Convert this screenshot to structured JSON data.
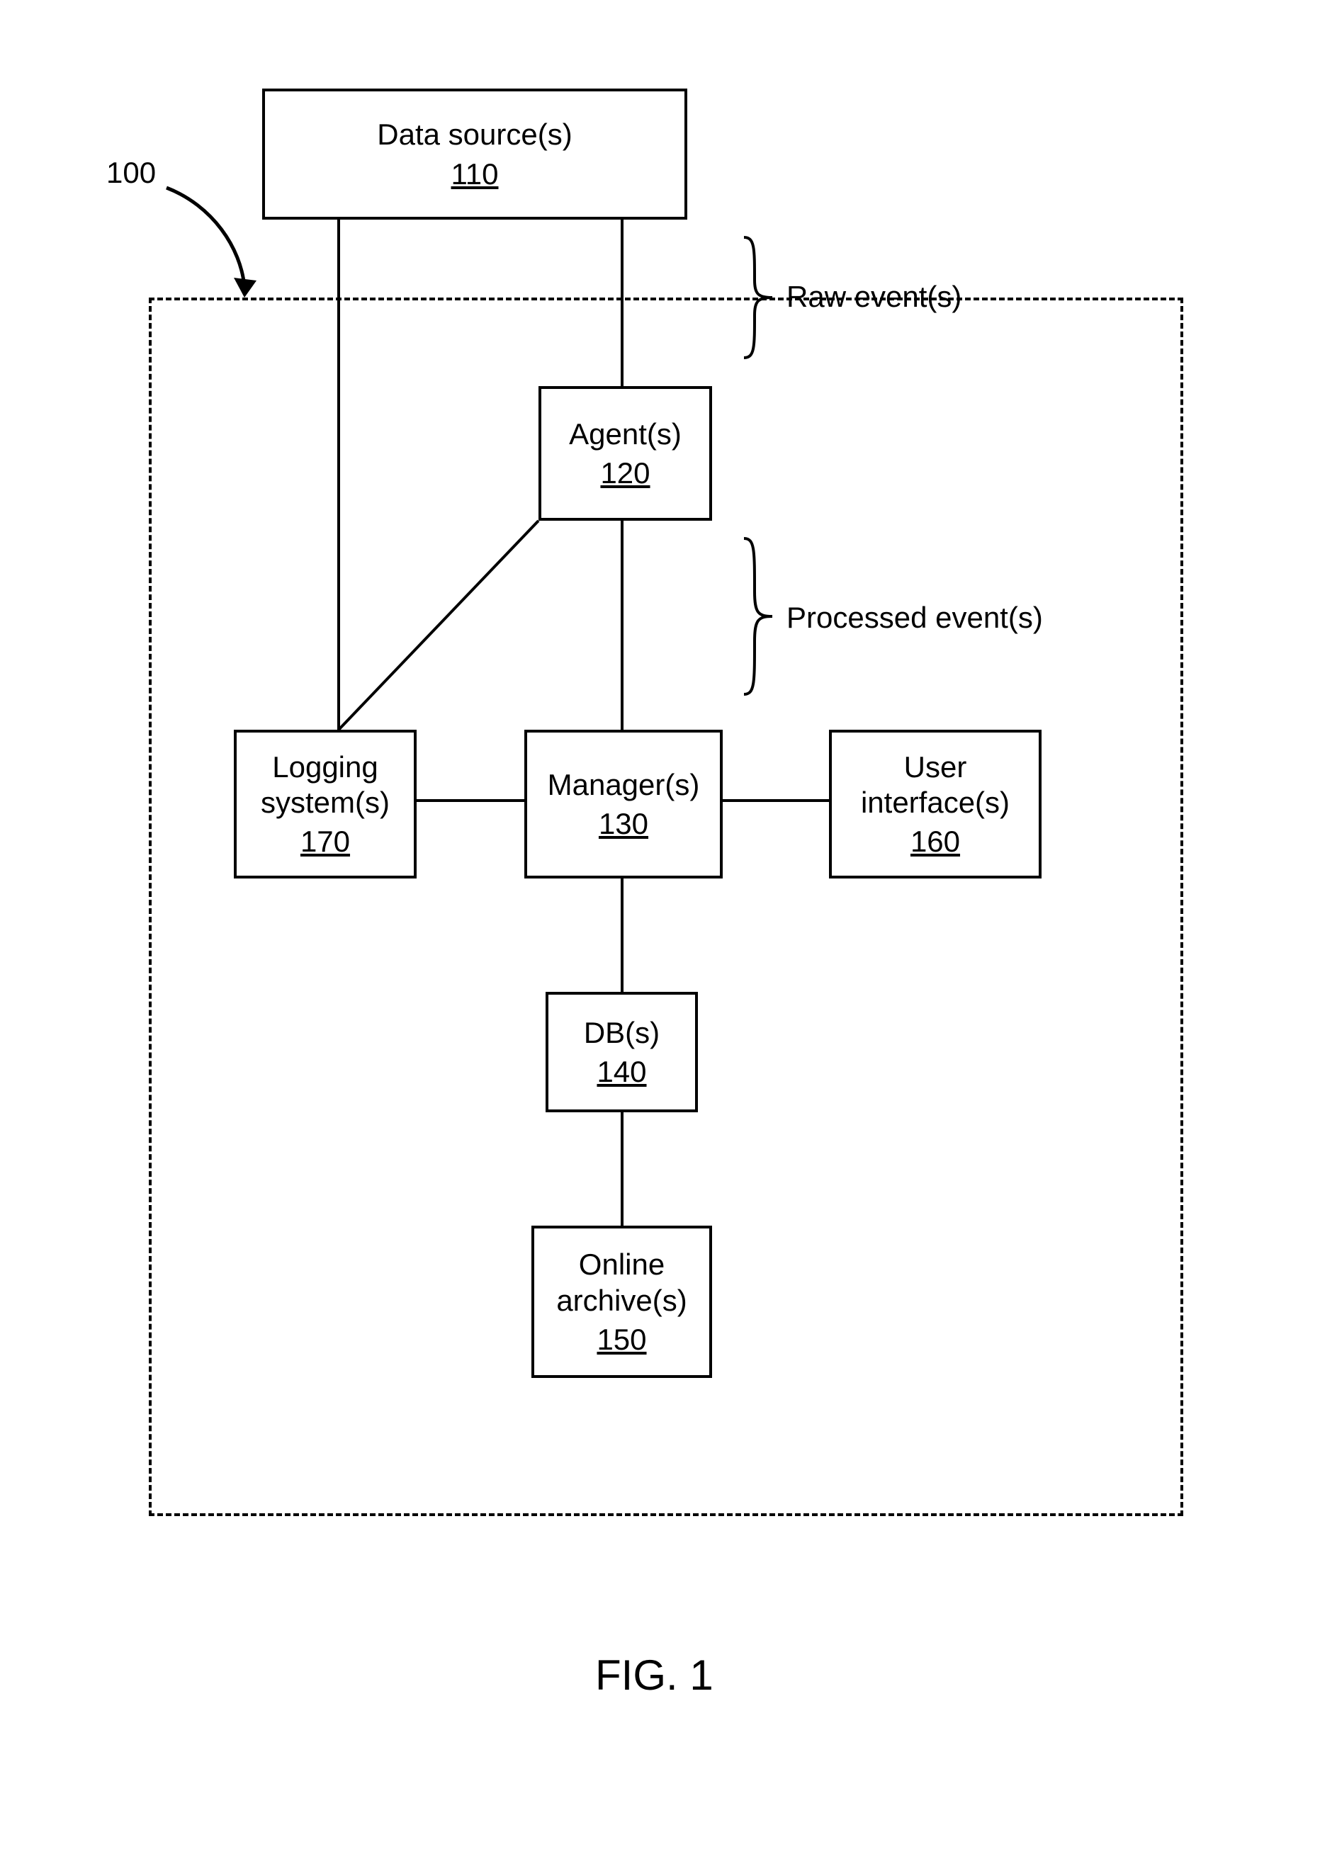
{
  "figure": {
    "reference_number": "100",
    "caption": "FIG. 1",
    "annotations": {
      "raw_events": "Raw event(s)",
      "processed_events": "Processed event(s)"
    },
    "boxes": {
      "data_sources": {
        "label": "Data source(s)",
        "ref": "110"
      },
      "agents": {
        "label": "Agent(s)",
        "ref": "120"
      },
      "managers": {
        "label": "Manager(s)",
        "ref": "130"
      },
      "dbs": {
        "label": "DB(s)",
        "ref": "140"
      },
      "archives": {
        "label": "Online\narchive(s)",
        "ref": "150"
      },
      "ui": {
        "label": "User\ninterface(s)",
        "ref": "160"
      },
      "logging": {
        "label": "Logging\nsystem(s)",
        "ref": "170"
      }
    }
  }
}
